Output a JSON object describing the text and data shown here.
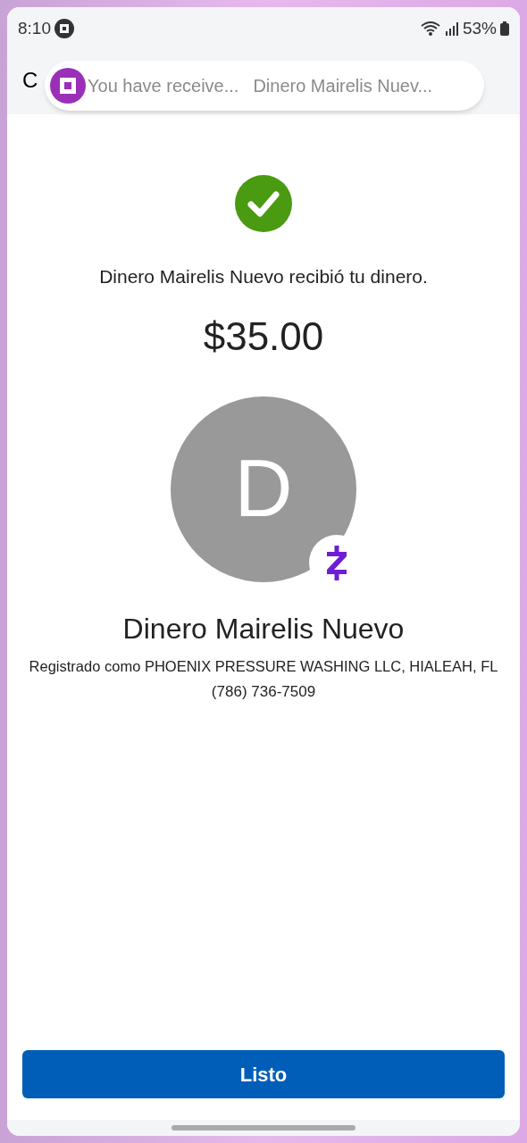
{
  "status_bar": {
    "time": "8:10",
    "battery": "53%"
  },
  "header": {
    "title": "C"
  },
  "notification": {
    "title": "You have receive...",
    "text": "Dinero Mairelis Nuev..."
  },
  "confirmation": {
    "message": "Dinero Mairelis Nuevo recibió tu dinero.",
    "amount": "$35.00"
  },
  "recipient": {
    "initial": "D",
    "name": "Dinero Mairelis Nuevo",
    "registered": "Registrado como PHOENIX PRESSURE WASHING LLC, HIALEAH, FL",
    "phone": "(786) 736-7509"
  },
  "buttons": [
    "Listo"
  ]
}
